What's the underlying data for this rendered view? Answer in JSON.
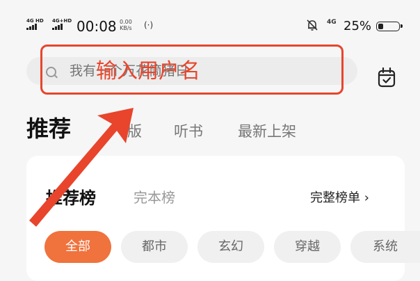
{
  "status_bar": {
    "net1": "4G HD",
    "net2": "4G+HD",
    "time": "00:08",
    "speed_value": "0.00",
    "speed_unit": "KB/s",
    "hotspot": "(·)",
    "network_right": "4G",
    "battery": "25%",
    "battery_level": 0.25
  },
  "search": {
    "placeholder": "我有一个万花筒猪日",
    "annotation": "输入用户名"
  },
  "tabs": {
    "main": "推荐",
    "items": [
      "版",
      "听书",
      "最新上架"
    ]
  },
  "card": {
    "title": "推荐榜",
    "alt_tab": "完本榜",
    "link": "完整榜单 ›",
    "chips": [
      "全部",
      "都市",
      "玄幻",
      "穿越",
      "系统"
    ]
  },
  "colors": {
    "accent": "#e8452c",
    "chip_active": "#f0723d"
  }
}
